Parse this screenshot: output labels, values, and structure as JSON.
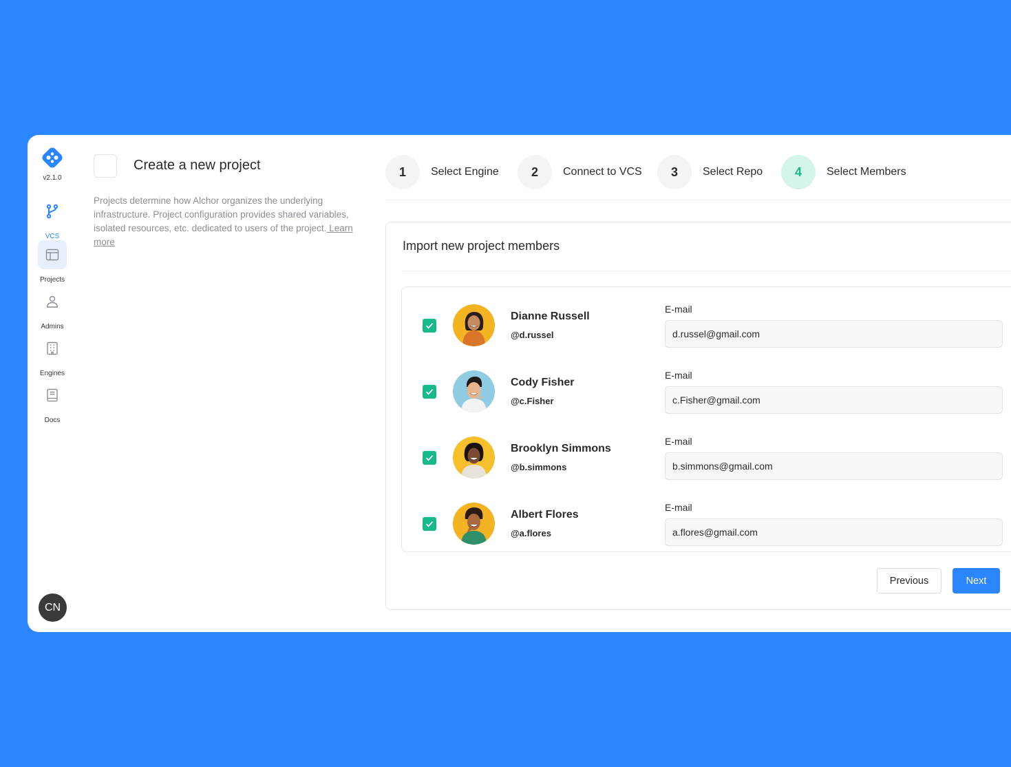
{
  "app": {
    "version": "v2.1.0",
    "user_initials": "CN",
    "accent_color": "#2a85fe",
    "success_color": "#18b98b"
  },
  "sidebar": {
    "items": [
      {
        "label": "VCS",
        "icon": "branch-icon"
      },
      {
        "label": "Projects",
        "icon": "layout-icon"
      },
      {
        "label": "Admins",
        "icon": "user-icon"
      },
      {
        "label": "Engines",
        "icon": "building-icon"
      },
      {
        "label": "Docs",
        "icon": "book-icon"
      }
    ]
  },
  "intro": {
    "title": "Create a new project",
    "description": "Projects determine how Alchor organizes the underlying infrastructure.  Project configuration provides shared variables, isolated resources,  etc. dedicated to users of the project.",
    "learn_more": " Learn more"
  },
  "steps": [
    {
      "number": "1",
      "label": "Select Engine"
    },
    {
      "number": "2",
      "label": "Connect to VCS"
    },
    {
      "number": "3",
      "label": "Select Repo"
    },
    {
      "number": "4",
      "label": "Select Members"
    }
  ],
  "panel": {
    "title": "Import new project members",
    "email_label": "E-mail",
    "members": [
      {
        "name": "Dianne Russell",
        "handle": "@d.russel",
        "email": "d.russel@gmail.com",
        "checked": true
      },
      {
        "name": "Cody Fisher",
        "handle": "@c.Fisher",
        "email": "c.Fisher@gmail.com",
        "checked": true
      },
      {
        "name": "Brooklyn Simmons",
        "handle": "@b.simmons",
        "email": "b.simmons@gmail.com",
        "checked": true
      },
      {
        "name": "Albert Flores",
        "handle": "@a.flores",
        "email": "a.flores@gmail.com",
        "checked": true
      }
    ]
  },
  "actions": {
    "previous": "Previous",
    "next": "Next"
  }
}
